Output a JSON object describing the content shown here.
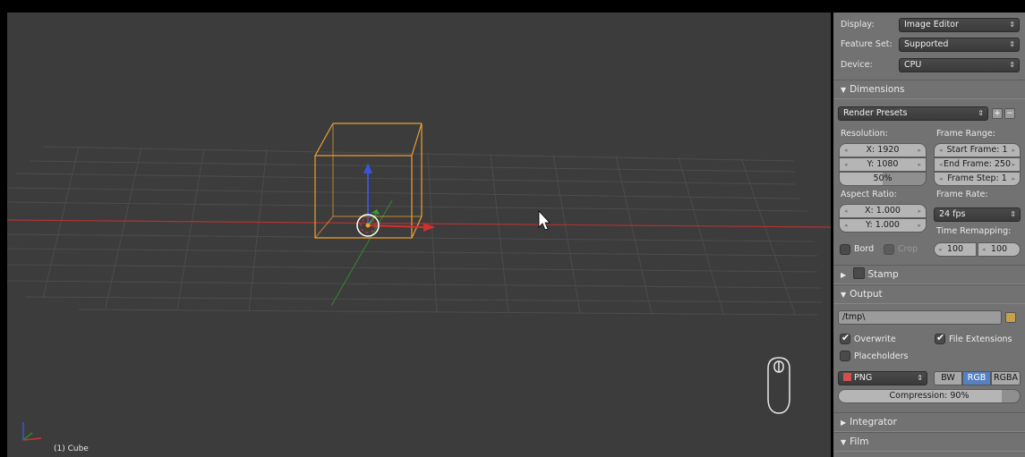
{
  "viewport": {
    "object_label": "(1) Cube"
  },
  "panel": {
    "display_label": "Display:",
    "display_value": "Image Editor",
    "feature_set_label": "Feature Set:",
    "feature_set_value": "Supported",
    "device_label": "Device:",
    "device_value": "CPU",
    "dimensions": {
      "title": "Dimensions",
      "render_presets": "Render Presets",
      "resolution_label": "Resolution:",
      "res_x": "X: 1920",
      "res_y": "Y: 1080",
      "res_pct": "50%",
      "frame_range_label": "Frame Range:",
      "start_frame": "Start Frame: 1",
      "end_frame": "End Frame: 250",
      "frame_step": "Frame Step: 1",
      "aspect_label": "Aspect Ratio:",
      "aspect_x": "X: 1.000",
      "aspect_y": "Y: 1.000",
      "frame_rate_label": "Frame Rate:",
      "frame_rate_value": "24 fps",
      "border_label": "Bord",
      "crop_label": "Crop",
      "time_remap_label": "Time Remapping:",
      "remap_old": "100",
      "remap_new": "100"
    },
    "stamp_title": "Stamp",
    "output": {
      "title": "Output",
      "path": "/tmp\\",
      "overwrite_label": "Overwrite",
      "file_ext_label": "File Extensions",
      "placeholders_label": "Placeholders",
      "format_value": "PNG",
      "bw_label": "BW",
      "rgb_label": "RGB",
      "rgba_label": "RGBA",
      "compression": "Compression: 90%",
      "compression_value": 0.9
    },
    "integrator_title": "Integrator",
    "film_title": "Film"
  },
  "colors": {
    "viewport_bg": "#3c3c3c",
    "panel_bg": "#727272",
    "selection_orange": "#f0a030",
    "active_blue": "#5680c2",
    "axis_red": "#c83232",
    "axis_green": "#2a9a2a"
  }
}
